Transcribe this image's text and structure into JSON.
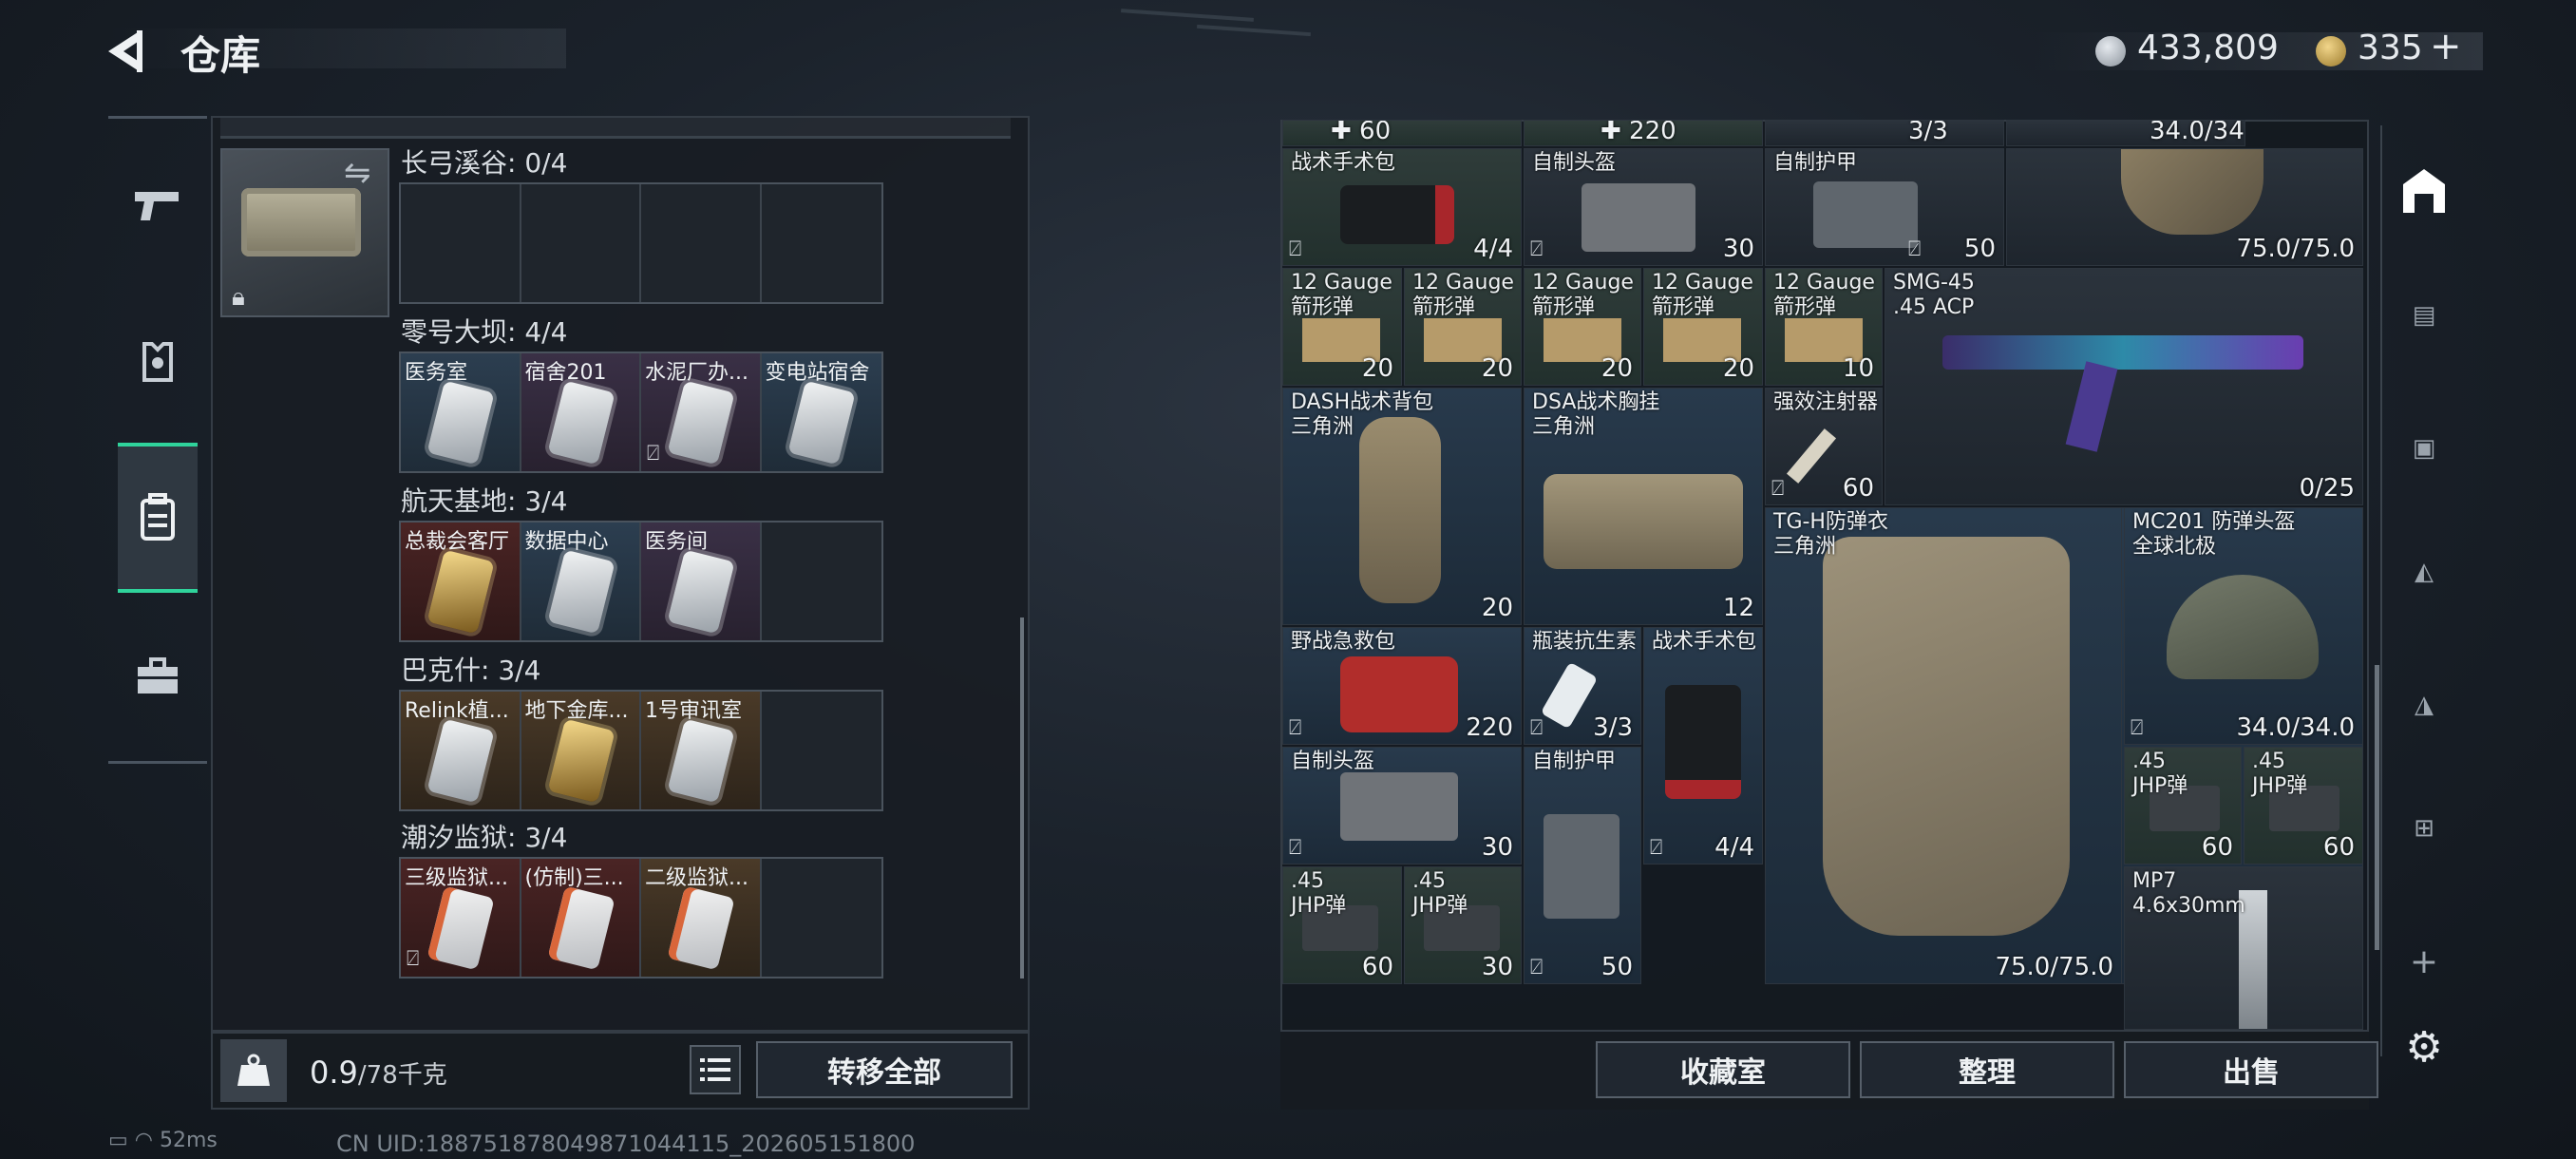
{
  "header": {
    "title": "仓库",
    "money": "433,809",
    "coupon": "335",
    "coupon_add": "+"
  },
  "colors": {
    "accent": "#2fd39b"
  },
  "left_nav": [
    {
      "icon": "pistol-icon"
    },
    {
      "icon": "armor-icon"
    },
    {
      "icon": "backpack-icon",
      "active": true
    },
    {
      "icon": "briefcase-icon"
    }
  ],
  "key_case": {
    "icon": "key-case-icon"
  },
  "sections": [
    {
      "title": "长弓溪谷: 0/4",
      "cells": []
    },
    {
      "title": "零号大坝: 4/4",
      "cells": [
        "医务室",
        "宿舍201",
        "水泥厂办...",
        "变电站宿舍"
      ]
    },
    {
      "title": "航天基地: 3/4",
      "cells": [
        "总裁会客厅",
        "数据中心",
        "医务间"
      ]
    },
    {
      "title": "巴克什: 3/4",
      "cells": [
        "Relink植...",
        "地下金库...",
        "1号审讯室"
      ]
    },
    {
      "title": "潮汐监狱: 3/4",
      "cells": [
        "三级监狱...",
        "(仿制)三...",
        "二级监狱..."
      ]
    }
  ],
  "weight": {
    "current": "0.9",
    "capacity": "/78千克"
  },
  "buttons": {
    "transfer_all": "转移全部",
    "collection": "收藏室",
    "organize": "整理",
    "sell": "出售"
  },
  "status": {
    "ping": "52ms",
    "uid": "CN UID:18875187804987104411​5_202605151800"
  },
  "stash_items": [
    {
      "name": "",
      "count": "✚ 60"
    },
    {
      "name": "",
      "count": "✚ 220"
    },
    {
      "name": "",
      "count": "3/3"
    },
    {
      "name": "",
      "count": "34.0/34.0"
    },
    {
      "name": "战术手术包",
      "count": "4/4"
    },
    {
      "name": "自制头盔",
      "count": "30"
    },
    {
      "name": "自制护甲",
      "count": "50"
    },
    {
      "name": "",
      "count": "75.0/75.0"
    },
    {
      "name": "12 Gauge\n箭形弹",
      "count": "20"
    },
    {
      "name": "12 Gauge\n箭形弹",
      "count": "20"
    },
    {
      "name": "12 Gauge\n箭形弹",
      "count": "20"
    },
    {
      "name": "12 Gauge\n箭形弹",
      "count": "20"
    },
    {
      "name": "12 Gauge\n箭形弹",
      "count": "10"
    },
    {
      "name": "SMG-45\n.45 ACP",
      "count": "0/25"
    },
    {
      "name": "DASH战术背包\n三角洲",
      "count": "20"
    },
    {
      "name": "DSA战术胸挂\n三角洲",
      "count": "12"
    },
    {
      "name": "强效注射器",
      "count": "60"
    },
    {
      "name": "TG-H防弹衣\n三角洲",
      "count": "75.0/75.0"
    },
    {
      "name": "MC201 防弹头盔\n全球北极",
      "count": "34.0/34.0"
    },
    {
      "name": "野战急救包",
      "count": "220"
    },
    {
      "name": "瓶装抗生素",
      "count": "3/3"
    },
    {
      "name": "战术手术包",
      "count": "4/4"
    },
    {
      "name": ".45\nJHP弹",
      "count": "60"
    },
    {
      "name": ".45\nJHP弹",
      "count": "60"
    },
    {
      "name": "自制头盔",
      "count": "30"
    },
    {
      "name": "自制护甲",
      "count": "50"
    },
    {
      "name": ".45\nJHP弹",
      "count": "60"
    },
    {
      "name": ".45\nJHP弹",
      "count": "30"
    },
    {
      "name": "MP7\n4.6x30mm",
      "count": ""
    }
  ]
}
